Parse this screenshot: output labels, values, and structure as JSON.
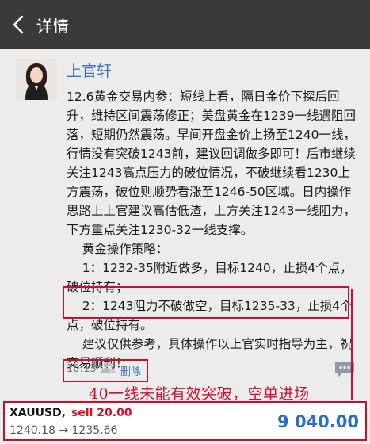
{
  "header": {
    "title": "详情"
  },
  "post": {
    "author": "上官轩",
    "content": "12.6黄金交易内参：短线上看，隔日金价下探后回升，维持区间震荡修正；美盘黄金在1239一线遇阻回落，短期仍然震荡。早间开盘金价上扬至1240一线，行情没有突破1243前，建议回调做多即可！后市继续关注1243高点压力的破位情况，不破继续看1230上方震荡，破位则顺势看涨至1246-50区域。日内操作思路上上官建议高估低渣，上方关注1243一线阻力，下方重点关注1230-32一线支撑。\n    黄金操作策略：\n    1：1232-35附近做多，目标1240，止损4个点，破位持有；\n    2：1243阻力不破做空，目标1235-33，止损4个点，破位持有。\n    建议仅供参考，具体操作以上官实时指导为主，祝交易顺利！",
    "time": "10:13",
    "delete_label": "删除"
  },
  "annotation": "40一线未能有效突破，空单进场",
  "trade": {
    "symbol": "XAUUSD,",
    "action": "sell 20.00",
    "prices": "1240.18 → 1235.66",
    "profit": "9 040.00"
  },
  "colors": {
    "topbar": "#3a3a3a",
    "link": "#3f73b5",
    "highlight": "#c8102e",
    "profit": "#2c6fc0"
  }
}
